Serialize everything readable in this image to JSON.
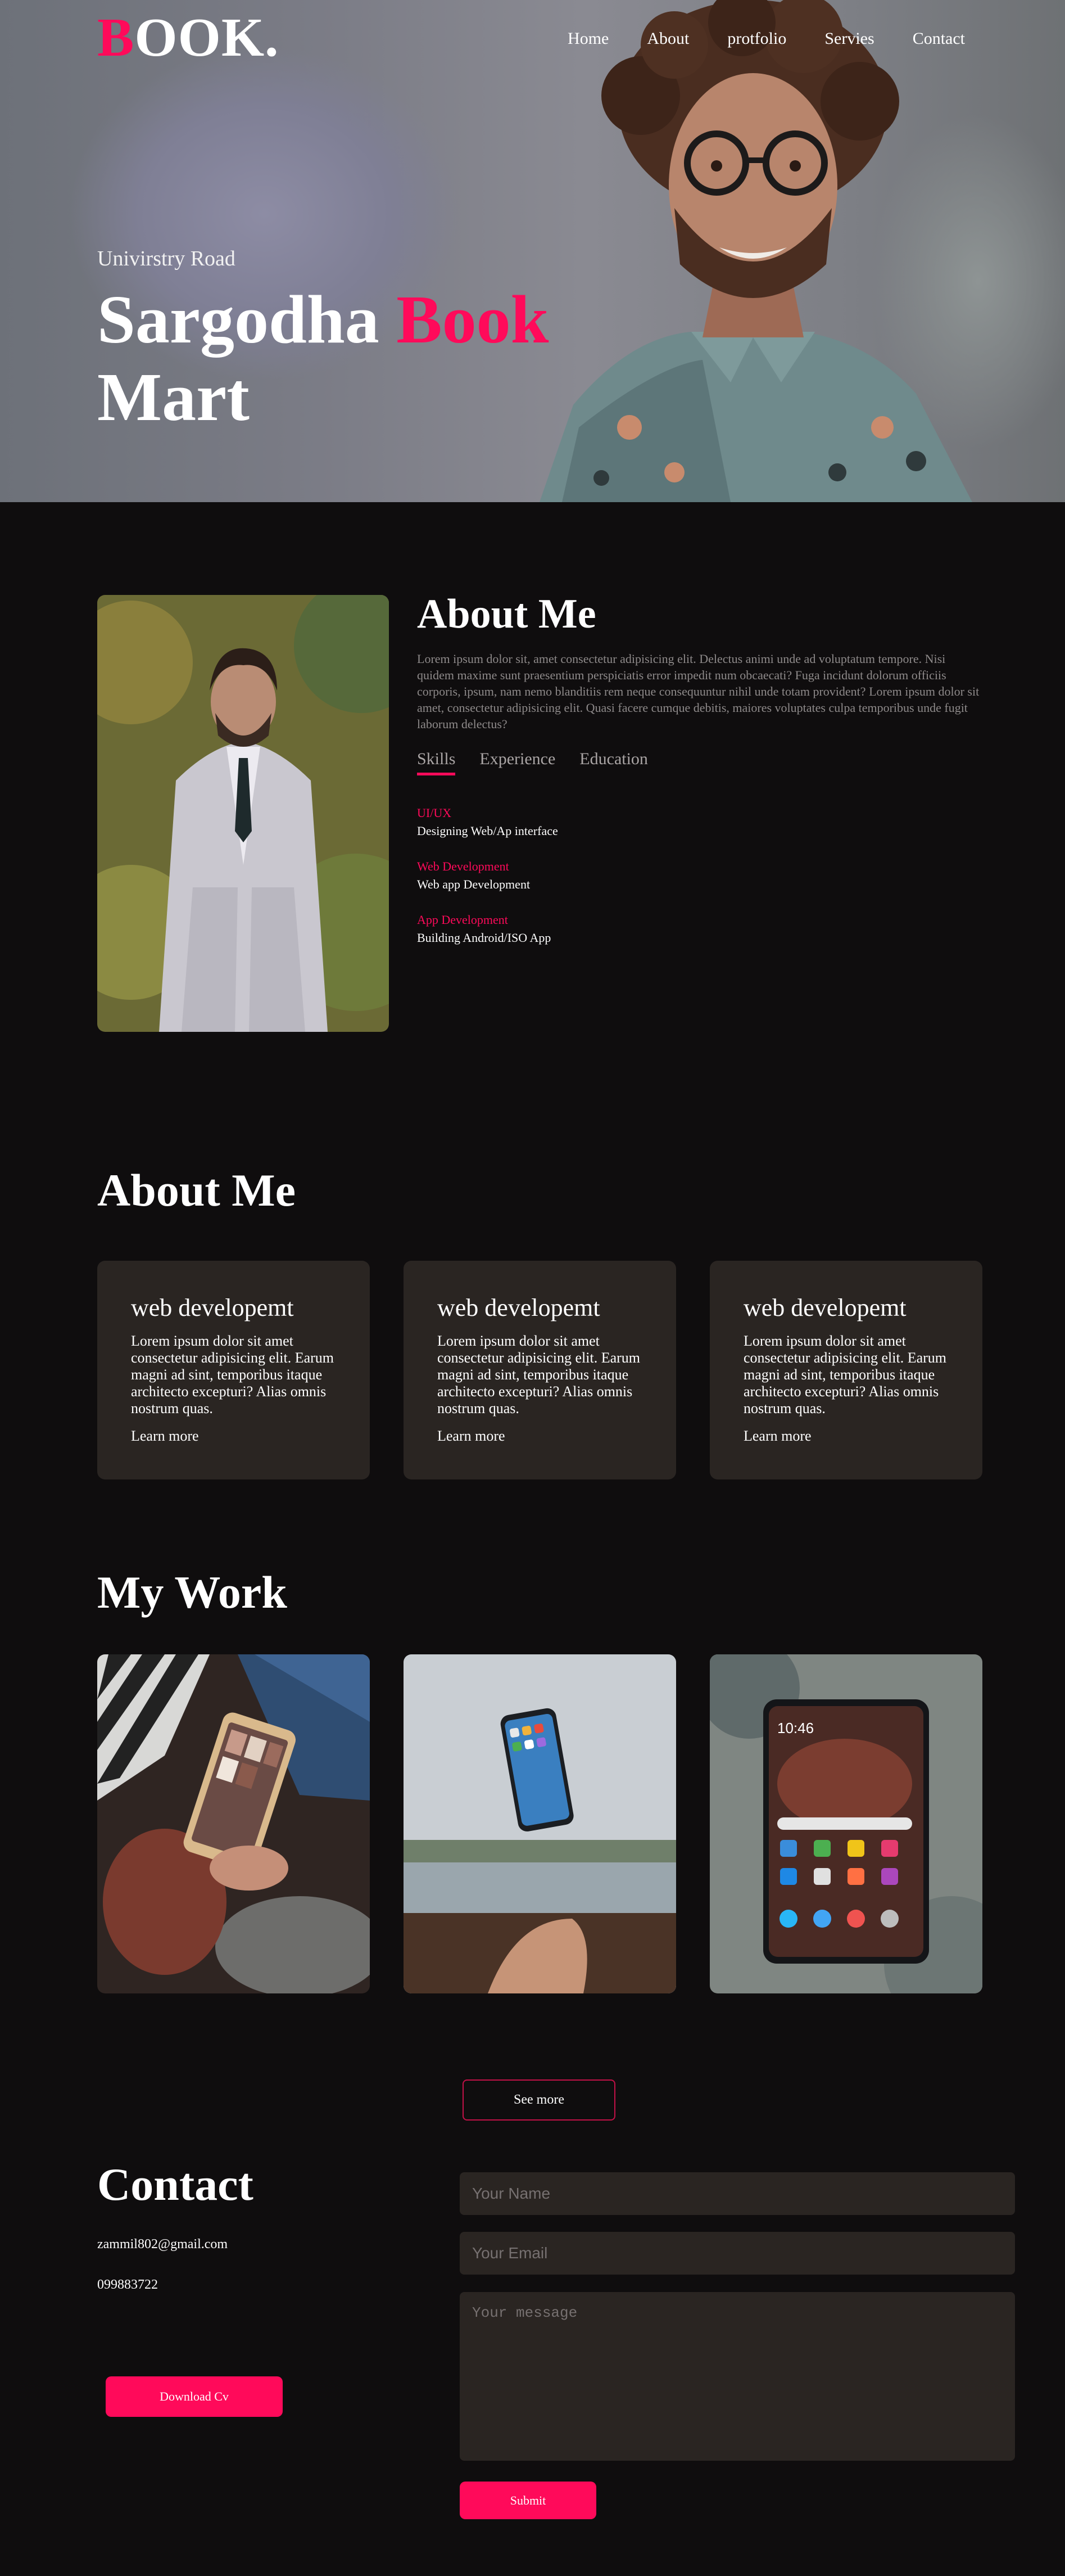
{
  "header": {
    "logo_first": "B",
    "logo_rest": "OOK.",
    "nav": [
      "Home",
      "About",
      "protfolio",
      "Servies",
      "Contact"
    ]
  },
  "hero": {
    "subtitle": "Univirstry Road",
    "title_part1": "Sargodha ",
    "title_accent": "Book",
    "title_part2": "Mart"
  },
  "about": {
    "title": "About Me",
    "text": "Lorem ipsum dolor sit, amet consectetur adipisicing elit. Delectus animi unde ad voluptatum tempore. Nisi quidem maxime sunt praesentium perspiciatis error impedit num obcaecati? Fuga incidunt dolorum officiis corporis, ipsum, nam nemo blanditiis rem neque consequuntur nihil unde totam provident? Lorem ipsum dolor sit amet, consectetur adipisicing elit. Quasi facere cumque debitis, maiores voluptates culpa temporibus unde fugit laborum delectus?",
    "tabs": [
      "Skills",
      "Experience",
      "Education"
    ],
    "active_tab": "Skills",
    "skills": [
      {
        "title": "UI/UX",
        "desc": "Designing Web/Ap interface"
      },
      {
        "title": "Web Development",
        "desc": "Web app Development"
      },
      {
        "title": "App Development",
        "desc": "Building Android/ISO App"
      }
    ]
  },
  "services": {
    "title": "About Me",
    "cards": [
      {
        "title": "web developemt",
        "body": "Lorem ipsum dolor sit amet consectetur adipisicing elit. Earum magni ad sint, temporibus itaque architecto excepturi? Alias omnis nostrum quas.",
        "link": "Learn more"
      },
      {
        "title": "web developemt",
        "body": "Lorem ipsum dolor sit amet consectetur adipisicing elit. Earum magni ad sint, temporibus itaque architecto excepturi? Alias omnis nostrum quas.",
        "link": "Learn more"
      },
      {
        "title": "web developemt",
        "body": "Lorem ipsum dolor sit amet consectetur adipisicing elit. Earum magni ad sint, temporibus itaque architecto excepturi? Alias omnis nostrum quas.",
        "link": "Learn more"
      }
    ]
  },
  "work": {
    "title": "My Work",
    "see_more": "See more"
  },
  "contact": {
    "title": "Contact",
    "email": "zammil802@gmail.com",
    "phone": "099883722",
    "download_cv": "Download Cv",
    "name_placeholder": "Your Name",
    "email_placeholder": "Your Email",
    "message_placeholder": "Your message",
    "submit": "Submit"
  },
  "colors": {
    "accent": "#ff0a5a",
    "background": "#0f0d0e",
    "card": "#2a2522"
  }
}
